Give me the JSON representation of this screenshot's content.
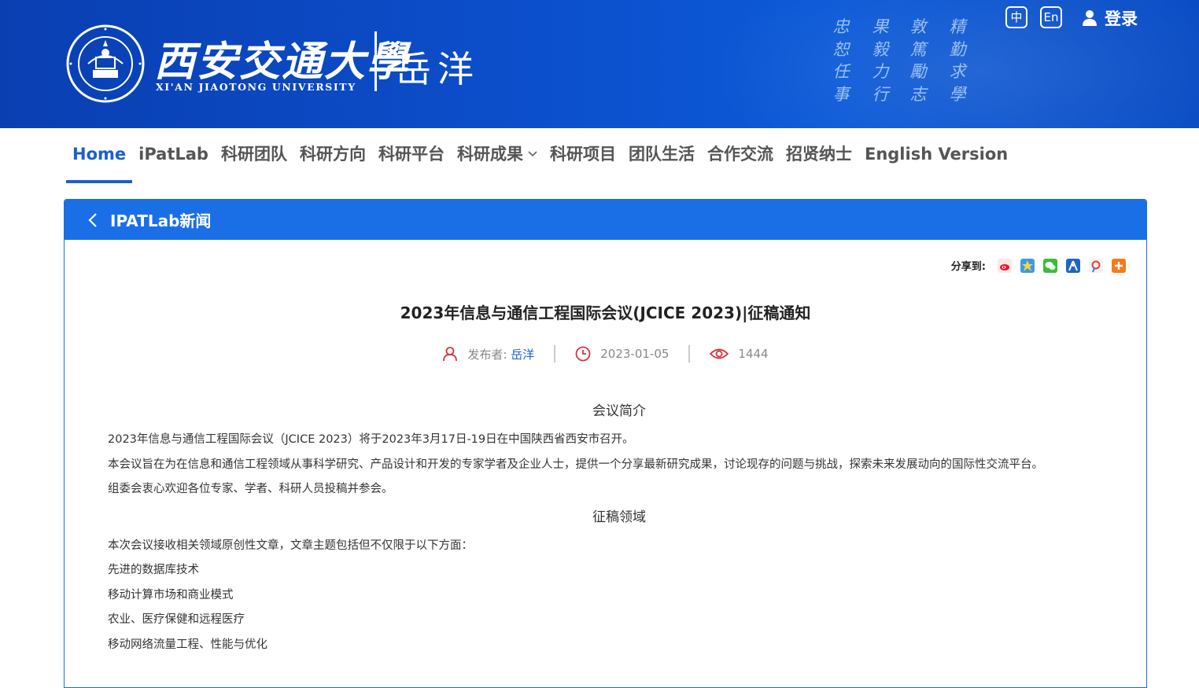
{
  "header": {
    "university_cn": "西安交通大學",
    "university_en": "XI'AN JIAOTONG UNIVERSITY",
    "person_name": "岳洋",
    "motto_columns": [
      [
        "精",
        "勤",
        "求",
        "學"
      ],
      [
        "敦",
        "篤",
        "勵",
        "志"
      ],
      [
        "果",
        "毅",
        "力",
        "行"
      ],
      [
        "忠",
        "恕",
        "任",
        "事"
      ]
    ],
    "lang_cn": "中",
    "lang_en": "En",
    "login": "登录",
    "emblem_icon": "xjtu-emblem"
  },
  "nav": {
    "items": [
      {
        "label": "Home",
        "active": true
      },
      {
        "label": "iPatLab"
      },
      {
        "label": "科研团队"
      },
      {
        "label": "科研方向"
      },
      {
        "label": "科研平台"
      },
      {
        "label": "科研成果",
        "dropdown": true
      },
      {
        "label": "科研项目"
      },
      {
        "label": "团队生活"
      },
      {
        "label": "合作交流"
      },
      {
        "label": "招贤纳士"
      },
      {
        "label": "English Version"
      }
    ]
  },
  "panel": {
    "title": "IPATLab新闻",
    "share_label": "分享到:",
    "share_icons": [
      "weibo-icon",
      "qzone-icon",
      "wechat-icon",
      "renren-icon",
      "tencent-weibo-icon",
      "more-share-icon"
    ]
  },
  "article": {
    "title": "2023年信息与通信工程国际会议(JCICE 2023)|征稿通知",
    "author_label": "发布者:",
    "author": "岳洋",
    "date": "2023-01-05",
    "views": "1444",
    "section1_heading": "会议简介",
    "section1": [
      "2023年信息与通信工程国际会议（JCICE 2023）将于2023年3月17日-19日在中国陕西省西安市召开。",
      "本会议旨在为在信息和通信工程领域从事科学研究、产品设计和开发的专家学者及企业人士，提供一个分享最新研究成果，讨论现存的问题与挑战，探索未来发展动向的国际性交流平台。",
      "组委会衷心欢迎各位专家、学者、科研人员投稿并参会。"
    ],
    "section2_heading": "征稿领域",
    "section2": [
      "本次会议接收相关领域原创性文章，文章主题包括但不仅限于以下方面：",
      "先进的数据库技术",
      "移动计算市场和商业模式",
      "农业、医疗保健和远程医疗",
      "移动网络流量工程、性能与优化"
    ]
  },
  "colors": {
    "header_blue": "#0c4fcc",
    "accent_blue": "#1a5fd0",
    "panel_blue": "#1a6fe6",
    "meta_icon_red": "#d9333f"
  }
}
